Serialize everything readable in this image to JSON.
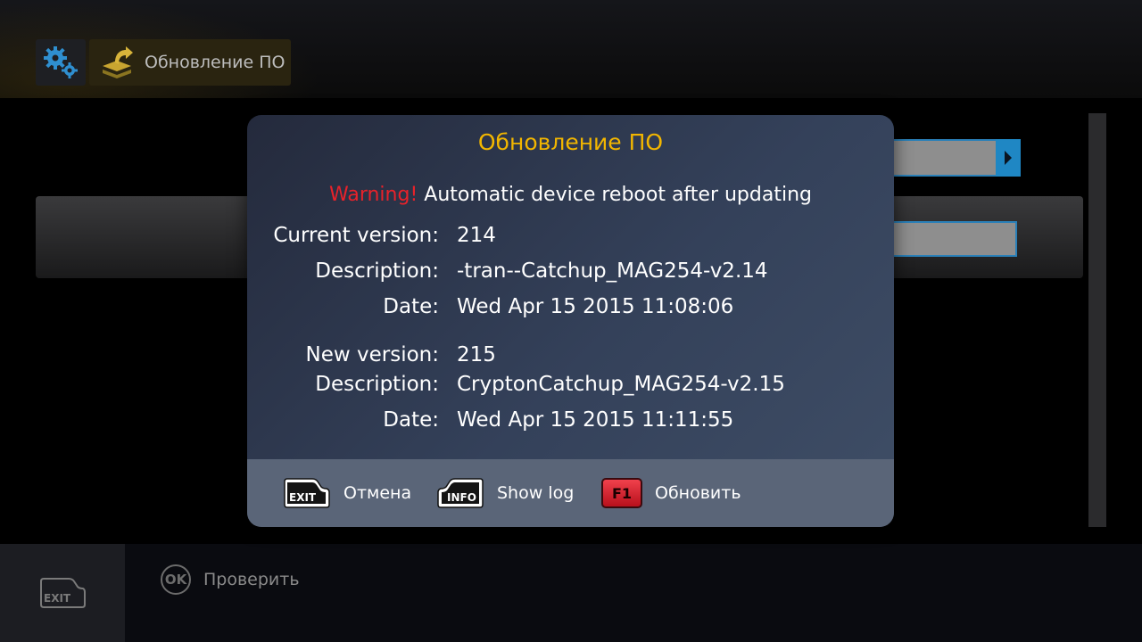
{
  "header": {
    "breadcrumb": [
      {
        "icon": "gears-icon"
      },
      {
        "icon": "update-icon",
        "label": "Обновление ПО"
      }
    ]
  },
  "dialog": {
    "title": "Обновление ПО",
    "warning_prefix": "Warning!",
    "warning_text": " Automatic device reboot after updating",
    "current": {
      "version_label": "Current version:",
      "version_value": "214",
      "description_label": "Description:",
      "description_value": "-tran--Catchup_MAG254-v2.14",
      "date_label": "Date:",
      "date_value": "Wed Apr 15 2015 11:08:06"
    },
    "new": {
      "version_label": "New version:",
      "version_value": "215",
      "description_label": "Description:",
      "description_value": "CryptonCatchup_MAG254-v2.15",
      "date_label": "Date:",
      "date_value": "Wed Apr 15 2015 11:11:55"
    },
    "footer": {
      "cancel": {
        "key": "EXIT",
        "label": "Отмена"
      },
      "log": {
        "key": "INFO",
        "label": "Show log"
      },
      "update": {
        "key": "F1",
        "label": "Обновить"
      }
    }
  },
  "bottom_bar": {
    "exit_key": "EXIT",
    "ok_key": "OK",
    "ok_label": "Проверить"
  },
  "colors": {
    "title_accent": "#f2b600",
    "warning": "#e8222a",
    "field_border": "#2a80b8"
  }
}
